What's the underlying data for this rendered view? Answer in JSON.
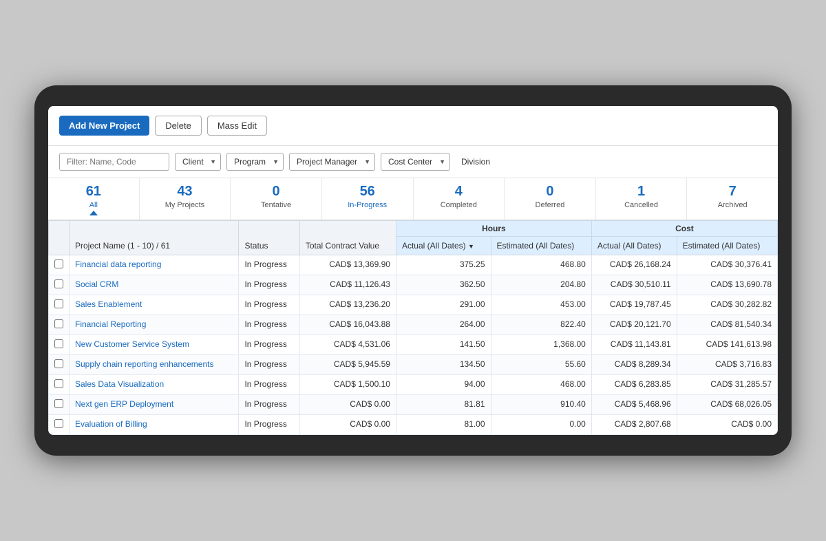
{
  "toolbar": {
    "add_button": "Add New Project",
    "delete_button": "Delete",
    "mass_edit_button": "Mass Edit"
  },
  "filters": {
    "name_placeholder": "Filter: Name, Code",
    "client_label": "Client",
    "program_label": "Program",
    "project_manager_label": "Project Manager",
    "cost_center_label": "Cost Center",
    "division_label": "Division"
  },
  "stats": [
    {
      "number": "61",
      "label": "All",
      "active": true
    },
    {
      "number": "43",
      "label": "My Projects",
      "active": false
    },
    {
      "number": "0",
      "label": "Tentative",
      "active": false
    },
    {
      "number": "56",
      "label": "In-Progress",
      "active": false
    },
    {
      "number": "4",
      "label": "Completed",
      "active": false
    },
    {
      "number": "0",
      "label": "Deferred",
      "active": false
    },
    {
      "number": "1",
      "label": "Cancelled",
      "active": false
    },
    {
      "number": "7",
      "label": "Archived",
      "active": false
    }
  ],
  "table": {
    "headers": {
      "project_name": "Project Name  (1 - 10) / 61",
      "status": "Status",
      "total_contract_value": "Total Contract Value",
      "hours_group": "Hours",
      "actual_all_dates": "Actual (All Dates)",
      "estimated_all_dates": "Estimated (All Dates)",
      "cost_group": "Cost",
      "cost_actual": "Actual (All Dates)",
      "cost_estimated": "Estimated (All Dates)"
    },
    "rows": [
      {
        "name": "Financial data reporting",
        "status": "In Progress",
        "total_contract_value": "CAD$ 13,369.90",
        "hours_actual": "375.25",
        "hours_estimated": "468.80",
        "cost_actual": "CAD$ 26,168.24",
        "cost_estimated": "CAD$ 30,376.41"
      },
      {
        "name": "Social CRM",
        "status": "In Progress",
        "total_contract_value": "CAD$ 11,126.43",
        "hours_actual": "362.50",
        "hours_estimated": "204.80",
        "cost_actual": "CAD$ 30,510.11",
        "cost_estimated": "CAD$ 13,690.78"
      },
      {
        "name": "Sales Enablement",
        "status": "In Progress",
        "total_contract_value": "CAD$ 13,236.20",
        "hours_actual": "291.00",
        "hours_estimated": "453.00",
        "cost_actual": "CAD$ 19,787.45",
        "cost_estimated": "CAD$ 30,282.82"
      },
      {
        "name": "Financial Reporting",
        "status": "In Progress",
        "total_contract_value": "CAD$ 16,043.88",
        "hours_actual": "264.00",
        "hours_estimated": "822.40",
        "cost_actual": "CAD$ 20,121.70",
        "cost_estimated": "CAD$ 81,540.34"
      },
      {
        "name": "New Customer Service System",
        "status": "In Progress",
        "total_contract_value": "CAD$ 4,531.06",
        "hours_actual": "141.50",
        "hours_estimated": "1,368.00",
        "cost_actual": "CAD$ 11,143.81",
        "cost_estimated": "CAD$ 141,613.98"
      },
      {
        "name": "Supply chain reporting enhancements",
        "status": "In Progress",
        "total_contract_value": "CAD$ 5,945.59",
        "hours_actual": "134.50",
        "hours_estimated": "55.60",
        "cost_actual": "CAD$ 8,289.34",
        "cost_estimated": "CAD$ 3,716.83"
      },
      {
        "name": "Sales Data Visualization",
        "status": "In Progress",
        "total_contract_value": "CAD$ 1,500.10",
        "hours_actual": "94.00",
        "hours_estimated": "468.00",
        "cost_actual": "CAD$ 6,283.85",
        "cost_estimated": "CAD$ 31,285.57"
      },
      {
        "name": "Next gen ERP Deployment",
        "status": "In Progress",
        "total_contract_value": "CAD$ 0.00",
        "hours_actual": "81.81",
        "hours_estimated": "910.40",
        "cost_actual": "CAD$ 5,468.96",
        "cost_estimated": "CAD$ 68,026.05"
      },
      {
        "name": "Evaluation of Billing",
        "status": "In Progress",
        "total_contract_value": "CAD$ 0.00",
        "hours_actual": "81.00",
        "hours_estimated": "0.00",
        "cost_actual": "CAD$ 2,807.68",
        "cost_estimated": "CAD$ 0.00"
      }
    ]
  }
}
